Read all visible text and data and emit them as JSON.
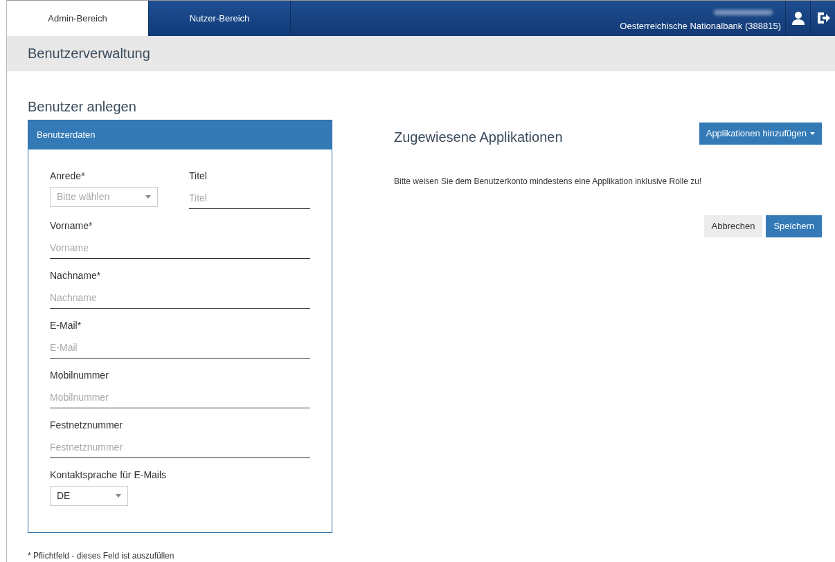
{
  "nav": {
    "tabs": [
      {
        "label": "Admin-Bereich",
        "selected": true
      },
      {
        "label": "Nutzer-Bereich",
        "selected": false
      }
    ],
    "organization": "Oesterreichische Nationalbank (388815)"
  },
  "page_title": "Benutzerverwaltung",
  "form": {
    "title": "Benutzer anlegen",
    "panel_title": "Benutzerdaten",
    "rows": [
      [
        {
          "kind": "select",
          "label": "Anrede*",
          "placeholder": "Bitte wählen"
        },
        {
          "kind": "text",
          "label": "Titel",
          "placeholder": "Titel"
        }
      ],
      [
        {
          "kind": "text",
          "label": "Vorname*",
          "placeholder": "Vorname"
        }
      ],
      [
        {
          "kind": "text",
          "label": "Nachname*",
          "placeholder": "Nachname"
        }
      ],
      [
        {
          "kind": "text",
          "label": "E-Mail*",
          "placeholder": "E-Mail"
        }
      ],
      [
        {
          "kind": "text",
          "label": "Mobilnummer",
          "placeholder": "Mobilnummer"
        }
      ],
      [
        {
          "kind": "text",
          "label": "Festnetznummer",
          "placeholder": "Festnetznummer"
        }
      ],
      [
        {
          "kind": "select",
          "label": "Kontaktsprache für E-Mails",
          "value": "DE"
        }
      ]
    ],
    "footnote": "* Pflichtfeld - dieses Feld ist auszufüllen"
  },
  "applications": {
    "title": "Zugewiesene Applikationen",
    "add_button": "Applikationen hinzufügen",
    "message": "Bitte weisen Sie dem Benutzerkonto mindestens eine Applikation inklusive Rolle zu!"
  },
  "buttons": [
    {
      "label": "Abbrechen",
      "kind": "secondary"
    },
    {
      "label": "Speichern",
      "kind": "primary"
    }
  ]
}
